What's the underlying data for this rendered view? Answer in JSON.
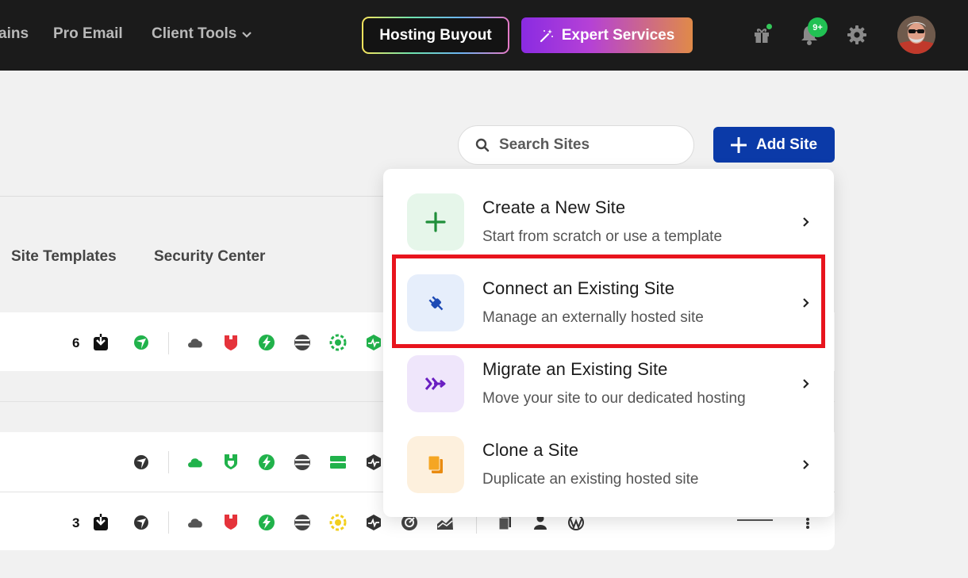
{
  "nav": {
    "links": [
      "ains",
      "Pro Email",
      "Client Tools"
    ],
    "buyout_label": "Hosting Buyout",
    "expert_label": "Expert Services",
    "notification_badge": "9+"
  },
  "toolbar": {
    "search_placeholder": "Search Sites",
    "add_site_label": "Add Site"
  },
  "tabs": [
    "Site Templates",
    "Security Center"
  ],
  "rows": [
    {
      "count": "6"
    },
    {
      "count": ""
    },
    {
      "count": "3"
    }
  ],
  "menu": {
    "items": [
      {
        "title": "Create a New Site",
        "desc": "Start from scratch or use a template"
      },
      {
        "title": "Connect an Existing Site",
        "desc": "Manage an externally hosted site"
      },
      {
        "title": "Migrate an Existing Site",
        "desc": "Move your site to our dedicated hosting"
      },
      {
        "title": "Clone a Site",
        "desc": "Duplicate an existing hosted site"
      }
    ],
    "highlighted_index": 1
  },
  "colors": {
    "brand_blue": "#0b3aa8",
    "highlight_red": "#e8141d",
    "status_green": "#21c153",
    "alert_red": "#e5333b"
  }
}
